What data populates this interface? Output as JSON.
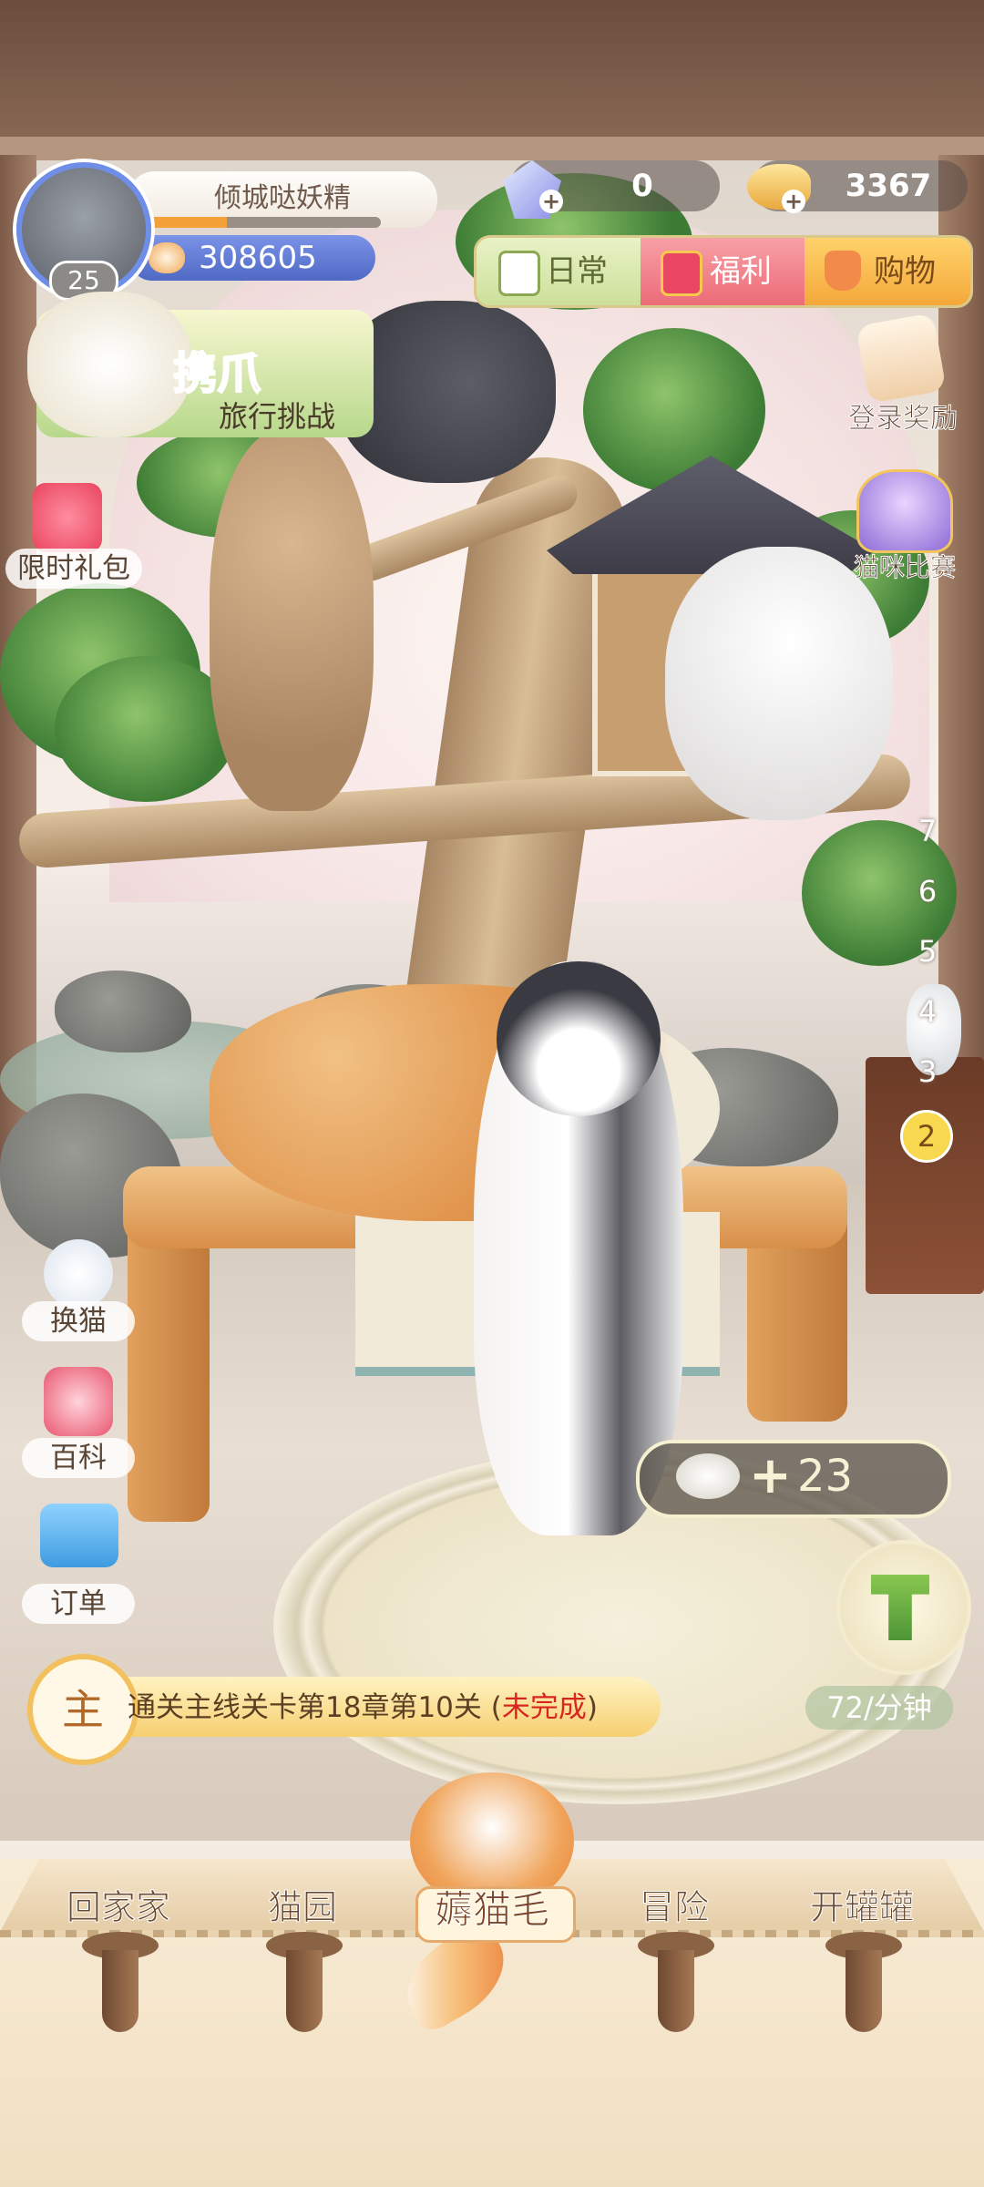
{
  "profile": {
    "name": "倾城哒妖精",
    "level": "25",
    "coins": "308605",
    "exp_progress": 0.35
  },
  "currency": {
    "gems": "0",
    "fish": "3367"
  },
  "top_tabs": [
    {
      "label": "日常",
      "icon": "checklist-icon"
    },
    {
      "label": "福利",
      "icon": "gift-icon"
    },
    {
      "label": "购物",
      "icon": "basket-icon"
    }
  ],
  "travel_challenge": {
    "line1": "携爪",
    "line2": "旅行挑战"
  },
  "limited_gift": {
    "label": "限时礼包"
  },
  "login_reward": {
    "label": "登录奖励"
  },
  "cat_contest": {
    "label": "猫咪比赛"
  },
  "floors": {
    "items": [
      "7",
      "6",
      "5",
      "4",
      "3",
      "2"
    ],
    "current": "2"
  },
  "side_buttons": [
    {
      "label": "换猫",
      "icon": "swap-cat-icon"
    },
    {
      "label": "百科",
      "icon": "encyclopedia-icon"
    },
    {
      "label": "订单",
      "icon": "ticket-icon"
    }
  ],
  "fur": {
    "plus": "+",
    "value": "23"
  },
  "comb": {
    "rate": "72/分钟"
  },
  "quest": {
    "badge": "主",
    "text": "通关主线关卡第18章第10关 ",
    "paren_open": "(",
    "status": "未完成",
    "paren_close": ")"
  },
  "bottom_nav": [
    {
      "label": "回家家"
    },
    {
      "label": "猫园"
    },
    {
      "label": "薅猫毛",
      "active": true
    },
    {
      "label": "冒险"
    },
    {
      "label": "开罐罐"
    }
  ],
  "colors": {
    "accent": "#f3a239",
    "coin_bar": "#5f77d2",
    "status_red": "#d8261f"
  }
}
